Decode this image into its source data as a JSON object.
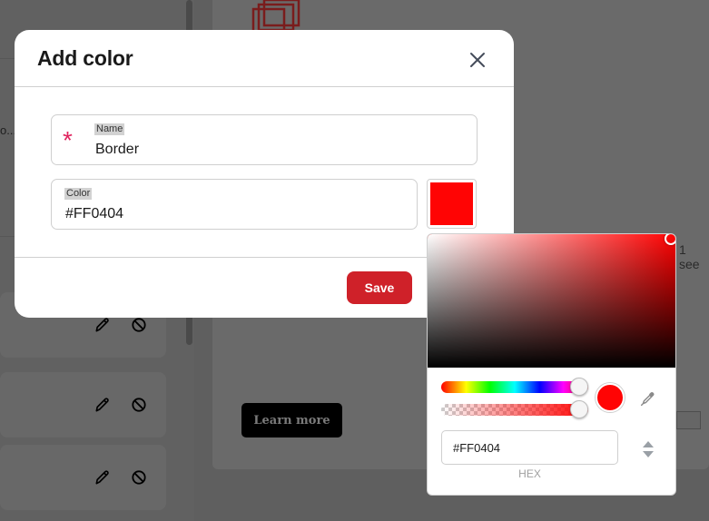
{
  "background": {
    "truncated_text": "o...",
    "see_text": "1 see",
    "learn_more": "Learn more"
  },
  "modal": {
    "title": "Add color",
    "name_field": {
      "label": "Name",
      "value": "Border",
      "required_marker": "*"
    },
    "color_field": {
      "label": "Color",
      "value": "#FF0404"
    },
    "swatch_color": "#FF0404",
    "save_label": "Save"
  },
  "picker": {
    "hue_color": "#FF0000",
    "selected_color": "#FF0404",
    "hex_value": "#FF0404",
    "hex_label": "HEX",
    "hue": 0,
    "alpha": 1
  }
}
